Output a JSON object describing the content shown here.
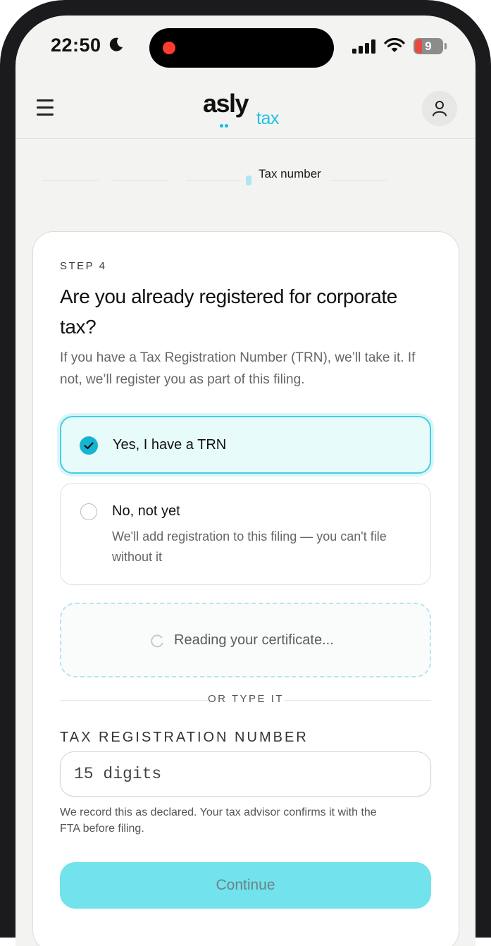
{
  "status_bar": {
    "time": "22:50",
    "battery": "9",
    "icons": [
      "moon-icon",
      "signal-icon",
      "wifi-icon",
      "battery-icon"
    ]
  },
  "app_bar": {
    "logo_main": "asly",
    "logo_sub": "tax",
    "menu_icon": "hamburger-menu-icon",
    "account_icon": "user-icon"
  },
  "stepper": {
    "current_label": "Tax number"
  },
  "step": {
    "eyebrow": "STEP 4",
    "title": "Are you already registered for corporate tax?",
    "description": "If you have a Tax Registration Number (TRN), we’ll take it. If not, we’ll register you as part of this filing."
  },
  "options": {
    "yes": {
      "label": "Yes, I have a TRN",
      "selected": true
    },
    "no": {
      "label": "No, not yet",
      "sublabel": "We'll add registration to this filing — you can't file without it",
      "selected": false
    }
  },
  "upload": {
    "status_text": "Reading your certificate..."
  },
  "divider": {
    "text": "OR TYPE IT"
  },
  "trn_field": {
    "label": "TAX REGISTRATION NUMBER",
    "placeholder": "15 digits",
    "value": "",
    "help": "We record this as declared. Your tax advisor confirms it with the FTA before filing."
  },
  "actions": {
    "continue_label": "Continue"
  },
  "colors": {
    "accent": "#15b4d3",
    "selected_bg": "#e8fbfb",
    "button_bg": "#72e2ec"
  }
}
